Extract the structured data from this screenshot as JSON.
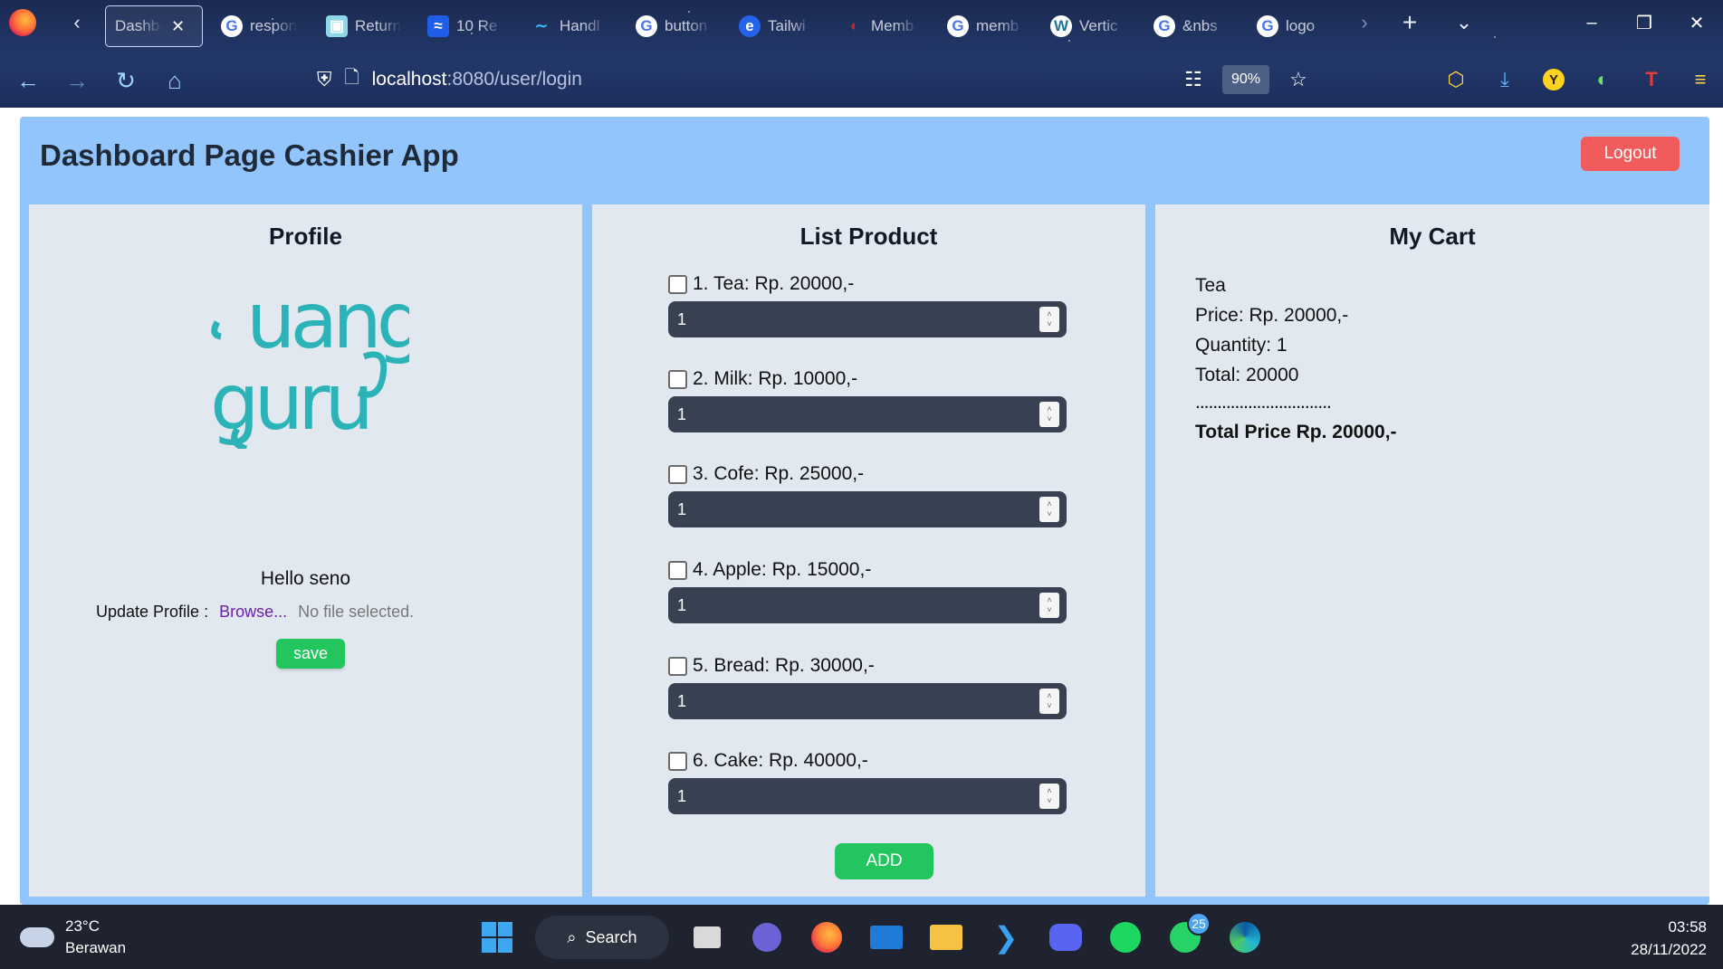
{
  "browser": {
    "tabs": [
      {
        "title": "Dashboard",
        "icon": "page-icon",
        "active": true
      },
      {
        "title": "responsive",
        "icon": "google-icon"
      },
      {
        "title": "Return",
        "icon": "android-icon"
      },
      {
        "title": "10 Re",
        "icon": "chart-icon"
      },
      {
        "title": "Handl",
        "icon": "tailwind-icon"
      },
      {
        "title": "button",
        "icon": "google-icon"
      },
      {
        "title": "Tailwi",
        "icon": "edge-icon"
      },
      {
        "title": "Memb",
        "icon": "memb-icon"
      },
      {
        "title": "memb",
        "icon": "google-icon"
      },
      {
        "title": "Vertic",
        "icon": "wordpress-icon"
      },
      {
        "title": "&nbs",
        "icon": "google-icon"
      },
      {
        "title": "logo",
        "icon": "google-icon"
      }
    ],
    "url_host": "localhost",
    "url_rest": ":8080/user/login",
    "zoom": "90%"
  },
  "app": {
    "title": "Dashboard Page Cashier App",
    "logout_label": "Logout",
    "profile": {
      "heading": "Profile",
      "logo_top": "uang",
      "logo_bottom": "guru",
      "greeting": "Hello seno",
      "update_label": "Update Profile :",
      "browse_label": "Browse...",
      "no_file": "No file selected.",
      "save_label": "save"
    },
    "products": {
      "heading": "List Product",
      "items": [
        {
          "label": "1. Tea: Rp. 20000,-",
          "qty": "1"
        },
        {
          "label": "2. Milk: Rp. 10000,-",
          "qty": "1"
        },
        {
          "label": "3. Cofe: Rp. 25000,-",
          "qty": "1"
        },
        {
          "label": "4. Apple: Rp. 15000,-",
          "qty": "1"
        },
        {
          "label": "5. Bread: Rp. 30000,-",
          "qty": "1"
        },
        {
          "label": "6. Cake: Rp. 40000,-",
          "qty": "1"
        }
      ],
      "add_label": "ADD"
    },
    "cart": {
      "heading": "My Cart",
      "item_name": "Tea",
      "price": "Price: Rp. 20000,-",
      "quantity": "Quantity: 1",
      "total": "Total: 20000",
      "separator": "...............................",
      "total_price": "Total Price Rp. 20000,-"
    }
  },
  "taskbar": {
    "temperature": "23°C",
    "weather": "Berawan",
    "search_label": "Search",
    "whatsapp_badge": "25",
    "time": "03:58",
    "date": "28/11/2022"
  },
  "colors": {
    "app_bg": "#93c5fd",
    "panel_bg": "#e2e8f0",
    "logout": "#f15b5b",
    "green": "#22c55e",
    "input_bg": "#374151",
    "logo": "#2bb3b8"
  }
}
